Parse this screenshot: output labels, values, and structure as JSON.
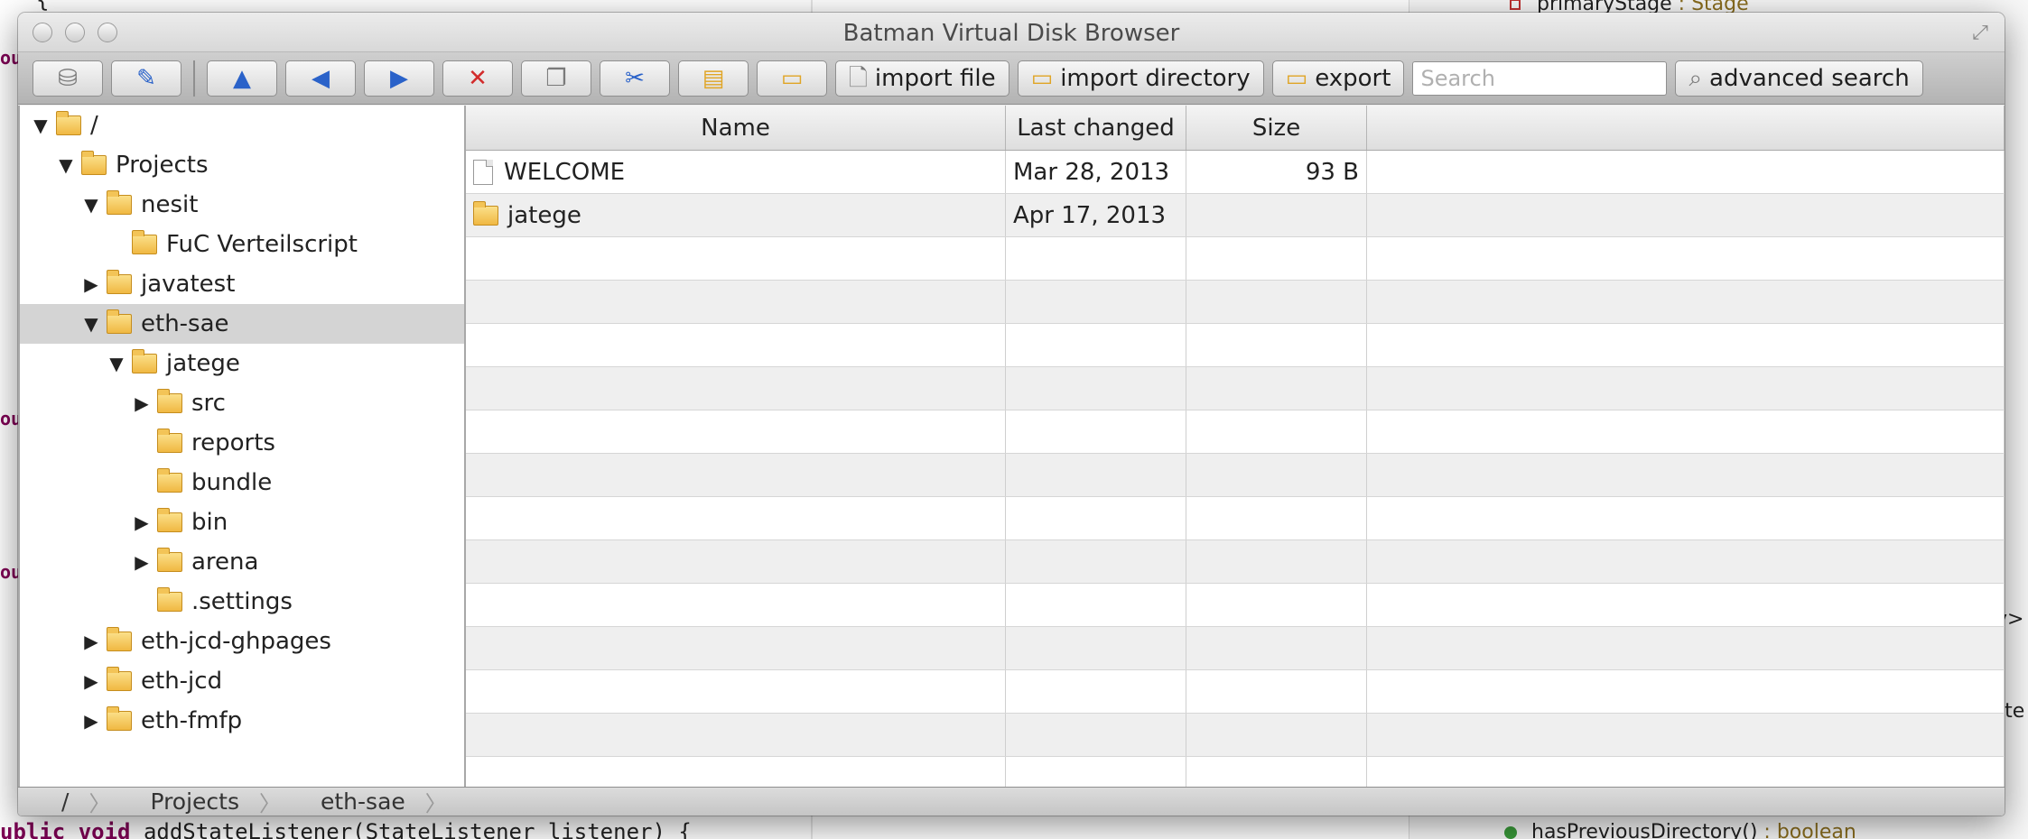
{
  "background": {
    "code_top": "{",
    "code_bottom_keyword1": "ublic",
    "code_bottom_keyword2": "void",
    "code_bottom_text": "addStateListener(StateListener listener) {",
    "frag_left": [
      "ou",
      "ou",
      "ou"
    ],
    "member_top_name": "primaryStage",
    "member_top_type": ": Stage",
    "member_bottom_name": "hasPreviousDirectory()",
    "member_bottom_type": ": boolean",
    "right_frag_1": "y>",
    "right_frag_2": "lte"
  },
  "window": {
    "title": "Batman Virtual Disk Browser"
  },
  "toolbar": {
    "import_file_label": "import file",
    "import_directory_label": "import directory",
    "export_label": "export",
    "search_placeholder": "Search",
    "advanced_search_label": "advanced search"
  },
  "tree": {
    "items": [
      {
        "label": "/",
        "disclosure": "▼",
        "indent": 0
      },
      {
        "label": "Projects",
        "disclosure": "▼",
        "indent": 1
      },
      {
        "label": "nesit",
        "disclosure": "▼",
        "indent": 2
      },
      {
        "label": "FuC Verteilscript",
        "disclosure": "",
        "indent": 3
      },
      {
        "label": "javatest",
        "disclosure": "▶",
        "indent": 2
      },
      {
        "label": "eth-sae",
        "disclosure": "▼",
        "indent": 2,
        "selected": true
      },
      {
        "label": "jatege",
        "disclosure": "▼",
        "indent": 3
      },
      {
        "label": "src",
        "disclosure": "▶",
        "indent": 4
      },
      {
        "label": "reports",
        "disclosure": "",
        "indent": 4
      },
      {
        "label": "bundle",
        "disclosure": "",
        "indent": 4
      },
      {
        "label": "bin",
        "disclosure": "▶",
        "indent": 4
      },
      {
        "label": "arena",
        "disclosure": "▶",
        "indent": 4
      },
      {
        "label": ".settings",
        "disclosure": "",
        "indent": 4
      },
      {
        "label": "eth-jcd-ghpages",
        "disclosure": "▶",
        "indent": 2
      },
      {
        "label": "eth-jcd",
        "disclosure": "▶",
        "indent": 2
      },
      {
        "label": "eth-fmfp",
        "disclosure": "▶",
        "indent": 2
      }
    ]
  },
  "table": {
    "headers": {
      "name": "Name",
      "date": "Last changed",
      "size": "Size"
    },
    "rows": [
      {
        "name": "WELCOME",
        "type": "file",
        "date": "Mar 28, 2013",
        "size": "93 B"
      },
      {
        "name": "jatege",
        "type": "folder",
        "date": "Apr 17, 2013",
        "size": ""
      }
    ]
  },
  "breadcrumb": [
    "/",
    "Projects",
    "eth-sae"
  ]
}
